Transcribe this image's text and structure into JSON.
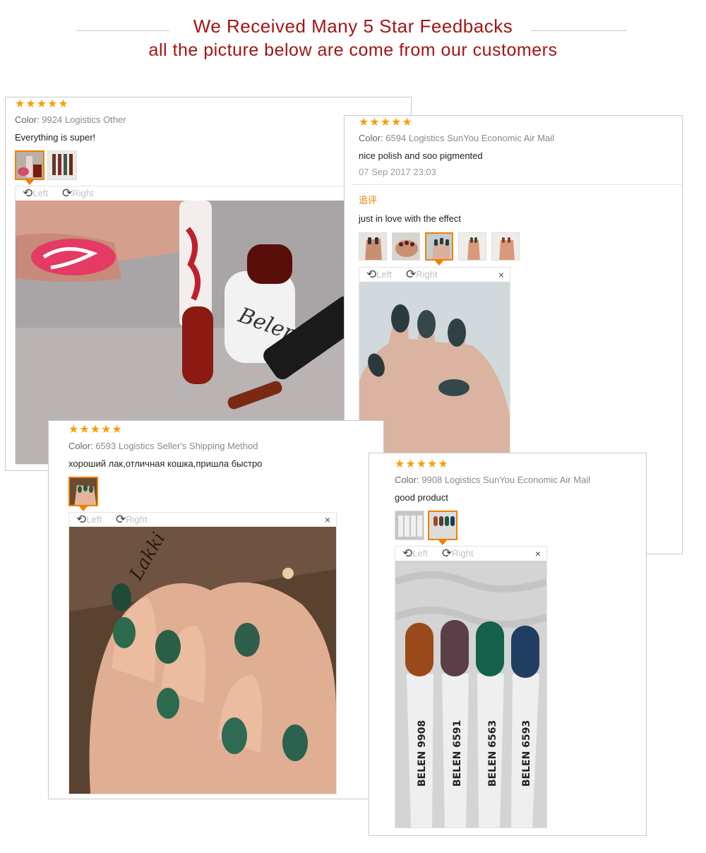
{
  "header": {
    "line1": "We Received Many 5 Star Feedbacks",
    "line2": "all the picture below are come from our customers"
  },
  "colors": {
    "title": "#a31515",
    "star": "#f5a000",
    "accent": "#f08000"
  },
  "rating_stars": "★★★★★",
  "reviews": [
    {
      "rating": 5,
      "color_label": "Color:",
      "color_value": "9924",
      "logistics_label": "Logistics",
      "logistics_value": "Other",
      "text": "Everything is super!",
      "thumbnails": 2,
      "selected_thumbnail": 1,
      "viewer": {
        "left_label": "Left",
        "right_label": "Right"
      }
    },
    {
      "rating": 5,
      "color_label": "Color:",
      "color_value": "6594",
      "logistics_label": "Logistics",
      "logistics_value": "SunYou Economic Air Mail",
      "text": "nice polish and soo pigmented",
      "date": "07 Sep 2017 23:03",
      "additional_label": "追评",
      "additional_text": "just in love with the effect",
      "thumbnails": 5,
      "selected_thumbnail": 3,
      "viewer": {
        "left_label": "Left",
        "right_label": "Right",
        "close": "×"
      }
    },
    {
      "rating": 5,
      "color_label": "Color:",
      "color_value": "6593",
      "logistics_label": "Logistics",
      "logistics_value": "Seller's Shipping Method",
      "text": "хороший лак,отличная кошка,пришла быстро",
      "thumbnails": 1,
      "selected_thumbnail": 1,
      "viewer": {
        "left_label": "Left",
        "right_label": "Right",
        "close": "×"
      }
    },
    {
      "rating": 5,
      "color_label": "Color:",
      "color_value": "9908",
      "logistics_label": "Logistics",
      "logistics_value": "SunYou Economic Air Mail",
      "text": "good product",
      "thumbnails": 2,
      "selected_thumbnail": 2,
      "viewer": {
        "left_label": "Left",
        "right_label": "Right",
        "close": "×"
      },
      "swatch_labels": [
        "BELEN 9908",
        "BELEN 6591",
        "BELEN 6563",
        "BELEN 6593"
      ]
    }
  ],
  "icons": {
    "rotate_left": "rotate-left-icon",
    "rotate_right": "rotate-right-icon",
    "close": "close-icon"
  }
}
